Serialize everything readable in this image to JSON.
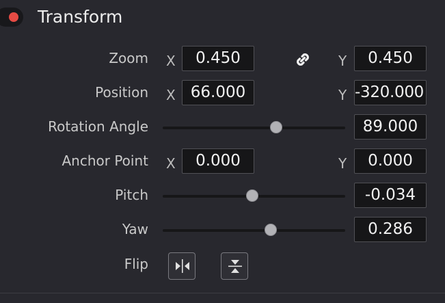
{
  "header": {
    "title": "Transform",
    "enabled_color": "#e64b44"
  },
  "rows": {
    "zoom": {
      "label": "Zoom",
      "x_label": "X",
      "x_value": "0.450",
      "y_label": "Y",
      "y_value": "0.450",
      "link_icon": "link-icon"
    },
    "position": {
      "label": "Position",
      "x_label": "X",
      "x_value": "66.000",
      "y_label": "Y",
      "y_value": "-320.000"
    },
    "rotation": {
      "label": "Rotation Angle",
      "value": "89.000",
      "slider_level": 0.62
    },
    "anchor": {
      "label": "Anchor Point",
      "x_label": "X",
      "x_value": "0.000",
      "y_label": "Y",
      "y_value": "0.000"
    },
    "pitch": {
      "label": "Pitch",
      "value": "-0.034",
      "slider_level": 0.49
    },
    "yaw": {
      "label": "Yaw",
      "value": "0.286",
      "slider_level": 0.59
    },
    "flip": {
      "label": "Flip",
      "horizontal_icon": "flip-horizontal-icon",
      "vertical_icon": "flip-vertical-icon"
    }
  }
}
